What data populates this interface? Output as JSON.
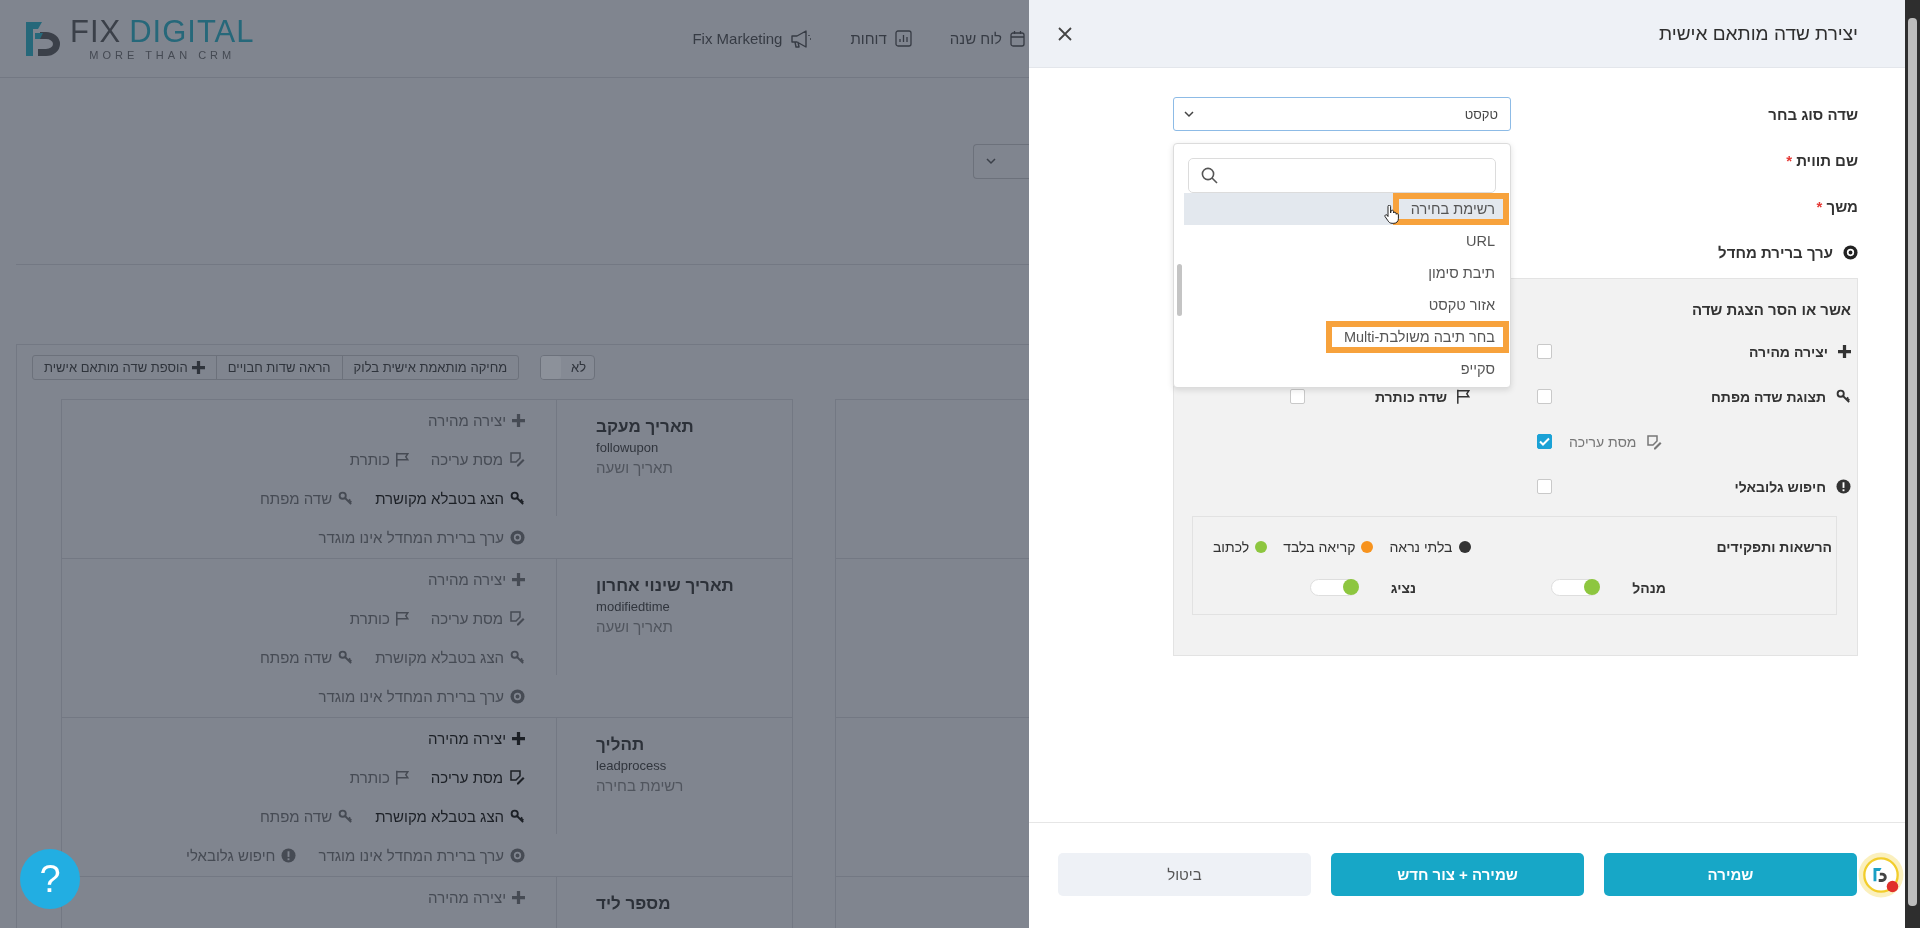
{
  "header": {
    "logo": {
      "word_1": "FIX",
      "word_2": "DIGITAL",
      "tagline": "MORE THAN CRM"
    },
    "nav": [
      {
        "label": "לוח שנה",
        "kind": "calendar"
      },
      {
        "label": "דוחות",
        "kind": "chart"
      },
      {
        "label": "Fix Marketing",
        "kind": "megaphone"
      }
    ]
  },
  "toolbar": {
    "toggle": {
      "label": "לא",
      "on": false
    },
    "buttons": [
      {
        "label": "מחיקה מותאמת אישית בלוק",
        "kind": "plain"
      },
      {
        "label": "הראה שדות חבויים",
        "kind": "plain"
      },
      {
        "label": "הוספת שדה מותאם אישית",
        "kind": "add"
      }
    ]
  },
  "fields": [
    {
      "title": "תאריך מעקב",
      "api_name": "followupon",
      "type": "תאריך ושעה",
      "actions": [
        [
          {
            "label": "יצירה מהירה",
            "kind": "plus",
            "enabled": false
          }
        ],
        [
          {
            "label": "מסת עריכה",
            "kind": "edit",
            "enabled": false
          },
          {
            "label": "כותרת",
            "kind": "flag",
            "enabled": false
          }
        ],
        [
          {
            "label": "הצג בטבלא מקושרת",
            "kind": "key",
            "enabled": true
          },
          {
            "label": "שדה מפתח",
            "kind": "key",
            "enabled": false
          }
        ],
        [
          {
            "label": "ערך ברירת המחדל אינו מוגדר",
            "kind": "default",
            "enabled": false
          }
        ]
      ]
    },
    {
      "title": "תאריך שינוי אחרון",
      "api_name": "modifiedtime",
      "type": "תאריך ושעה",
      "actions": [
        [
          {
            "label": "יצירה מהירה",
            "kind": "plus",
            "enabled": false
          }
        ],
        [
          {
            "label": "מסת עריכה",
            "kind": "edit",
            "enabled": false
          },
          {
            "label": "כותרת",
            "kind": "flag",
            "enabled": false
          }
        ],
        [
          {
            "label": "הצג בטבלא מקושרת",
            "kind": "key",
            "enabled": false
          },
          {
            "label": "שדה מפתח",
            "kind": "key",
            "enabled": false
          }
        ],
        [
          {
            "label": "ערך ברירת המחדל אינו מוגדר",
            "kind": "default",
            "enabled": false
          }
        ]
      ]
    },
    {
      "title": "תהליך",
      "api_name": "leadprocess",
      "type": "רשימת בחירה",
      "actions": [
        [
          {
            "label": "יצירה מהירה",
            "kind": "plus",
            "enabled": true
          }
        ],
        [
          {
            "label": "מסת עריכה",
            "kind": "edit",
            "enabled": true
          },
          {
            "label": "כותרת",
            "kind": "flag",
            "enabled": false
          }
        ],
        [
          {
            "label": "הצג בטבלא מקושרת",
            "kind": "key",
            "enabled": true
          },
          {
            "label": "שדה מפתח",
            "kind": "key",
            "enabled": false
          }
        ],
        [
          {
            "label": "ערך ברירת המחדל אינו מוגדר",
            "kind": "default",
            "enabled": false
          },
          {
            "label": "חיפוש גלובאלי",
            "kind": "info",
            "enabled": false
          }
        ]
      ]
    },
    {
      "title": "מספר ליד",
      "actions": [
        [
          {
            "label": "יצירה מהירה",
            "kind": "plus",
            "enabled": false
          }
        ]
      ]
    }
  ],
  "panel": {
    "title": "יצירת שדה מותאם אישית",
    "form": [
      {
        "label": "שדה סוג בחר",
        "kind": "select",
        "value": "טקסט"
      },
      {
        "label": "שם תווית",
        "kind": "label",
        "marker": "*"
      },
      {
        "label": "משך",
        "kind": "label",
        "marker": "*"
      },
      {
        "label": "ערך ברירת מחדל",
        "kind": "default"
      }
    ],
    "dropdown": {
      "options": [
        {
          "label": "רשימת בחירה",
          "highlighted": true,
          "annotated": true
        },
        {
          "label": "URL",
          "highlighted": false,
          "annotated": false
        },
        {
          "label": "תיבת סימון",
          "highlighted": false,
          "annotated": false
        },
        {
          "label": "אזור טקסט",
          "highlighted": false,
          "annotated": false
        },
        {
          "label": "בחר תיבה משולבת-Multi",
          "highlighted": false,
          "annotated": true
        },
        {
          "label": "סקייפ",
          "highlighted": false,
          "annotated": false
        }
      ]
    },
    "visibility": {
      "title": "אשר או הסר הצגת שדה",
      "rows": [
        [
          {
            "label": "יצירה מהירה",
            "kind": "plus",
            "checked": false,
            "muted": false
          }
        ],
        [
          {
            "label": "תצוגת שדה מפתח",
            "kind": "key",
            "checked": false,
            "muted": false
          },
          {
            "label": "שדה כותרת",
            "kind": "flag",
            "checked": false,
            "muted": false
          }
        ],
        [
          {
            "label": "מסת עריכה",
            "kind": "edit",
            "checked": true,
            "muted": true
          }
        ],
        [
          {
            "label": "חיפוש גלובאלי",
            "kind": "info",
            "checked": false,
            "muted": false
          }
        ]
      ]
    },
    "permissions": {
      "title": "הרשאות ותפקידים",
      "legend": [
        {
          "label": "בלתי נראה",
          "color": "#333333"
        },
        {
          "label": "קריאה בלבד",
          "color": "#f7931e"
        },
        {
          "label": "לכתוב",
          "color": "#8dc63f"
        }
      ],
      "roles": [
        {
          "label": "מנהל",
          "level": 1
        },
        {
          "label": "נציג",
          "level": 1
        }
      ]
    },
    "buttons": [
      {
        "label": "שמירה",
        "kind": "primary"
      },
      {
        "label": "שמירה + צור חדש",
        "kind": "primary"
      },
      {
        "label": "ביטול",
        "kind": "secondary"
      }
    ]
  },
  "help_button": {
    "label": "?"
  }
}
